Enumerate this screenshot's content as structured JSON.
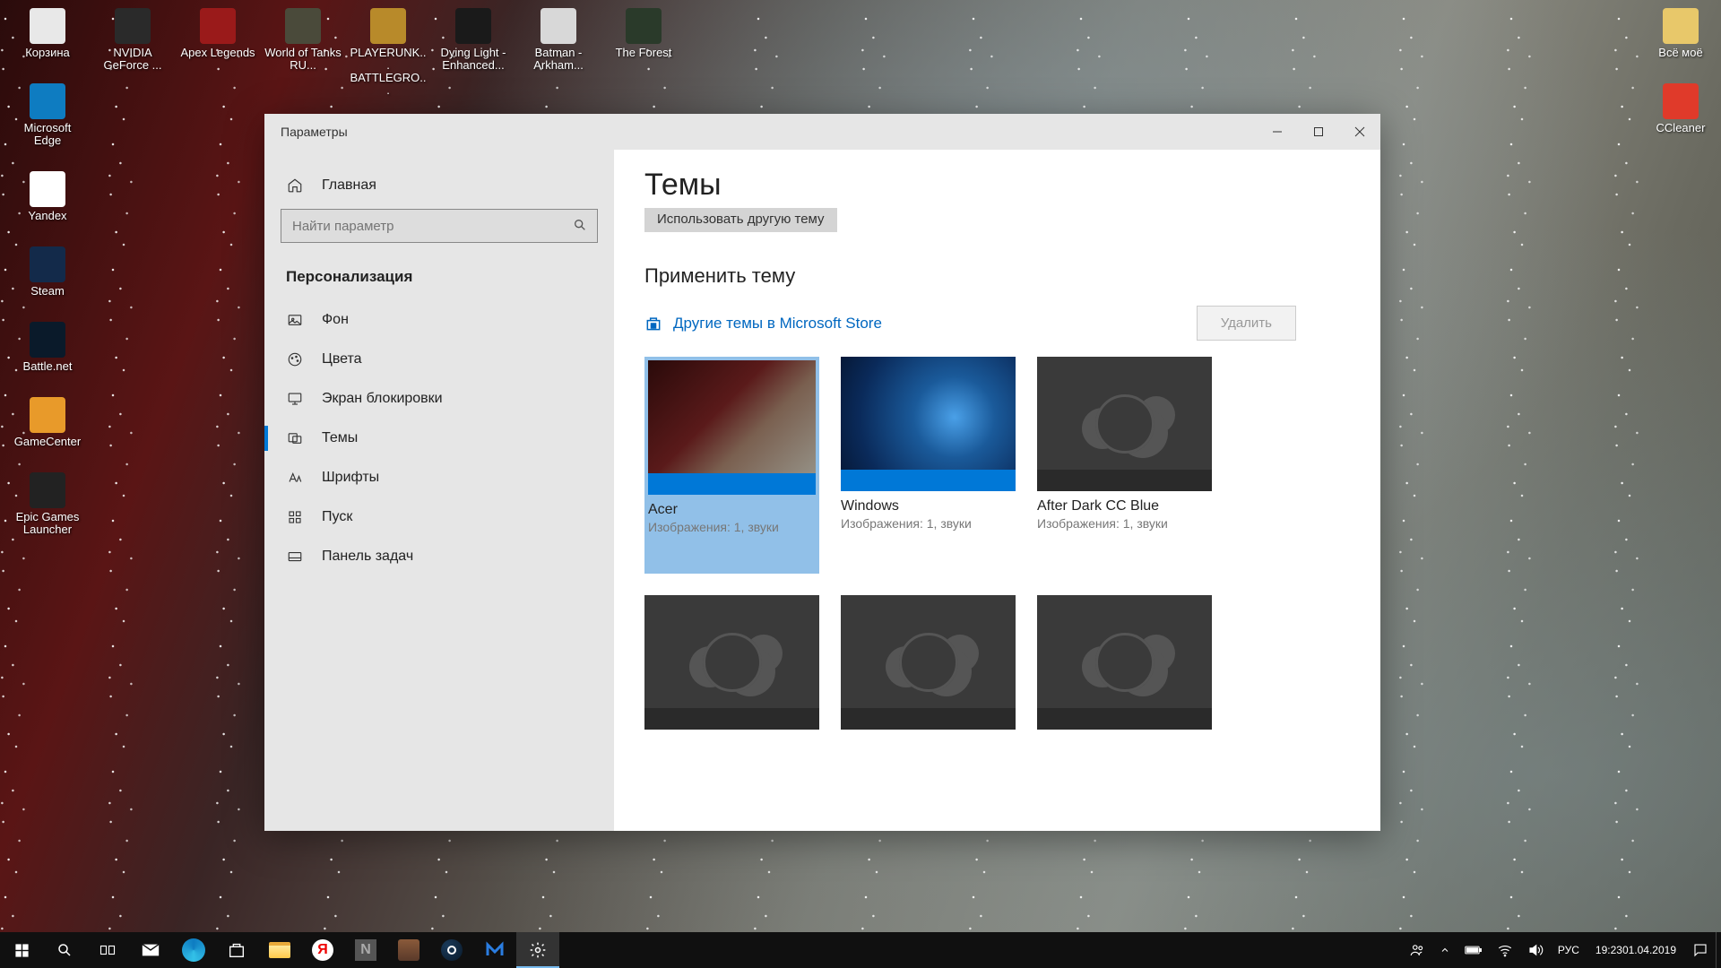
{
  "desktop_icons": {
    "col1": [
      "Корзина",
      "Microsoft Edge",
      "Yandex",
      "Steam",
      "Battle.net",
      "GameCenter",
      "Epic Games Launcher"
    ],
    "col2": [
      "NVIDIA GeForce ..."
    ],
    "col3": [
      "Apex Legends"
    ],
    "col4": [
      "World of Tanks RU..."
    ],
    "col5": [
      "PLAYERUNK... BATTLEGRO..."
    ],
    "col6": [
      "Dying Light - Enhanced..."
    ],
    "col7": [
      "Batman - Arkham..."
    ],
    "col8": [
      "The Forest"
    ],
    "col_right": [
      "Всё моё",
      "CCleaner"
    ]
  },
  "settings": {
    "window_title": "Параметры",
    "home_label": "Главная",
    "search_placeholder": "Найти параметр",
    "category_heading": "Персонализация",
    "nav": {
      "background": "Фон",
      "colors": "Цвета",
      "lockscreen": "Экран блокировки",
      "themes": "Темы",
      "fonts": "Шрифты",
      "start": "Пуск",
      "taskbar": "Панель задач"
    },
    "page_title": "Темы",
    "subtitle": "Использовать другую тему",
    "apply_heading": "Применить тему",
    "store_link": "Другие темы в Microsoft Store",
    "delete_label": "Удалить",
    "themes": [
      {
        "name": "Acer",
        "sub": "Изображения: 1, звуки",
        "selected": true,
        "style": "acer",
        "accent": "#0078d7"
      },
      {
        "name": "Windows",
        "sub": "Изображения: 1, звуки",
        "selected": false,
        "style": "win",
        "accent": "#0078d7"
      },
      {
        "name": "After Dark CC Blue",
        "sub": "Изображения: 1, звуки",
        "selected": false,
        "style": "dark",
        "accent": "#2a2a2a"
      },
      {
        "name": "",
        "sub": "",
        "selected": false,
        "style": "dark",
        "accent": "#2a2a2a"
      },
      {
        "name": "",
        "sub": "",
        "selected": false,
        "style": "dark",
        "accent": "#2a2a2a"
      },
      {
        "name": "",
        "sub": "",
        "selected": false,
        "style": "dark",
        "accent": "#2a2a2a"
      }
    ]
  },
  "taskbar": {
    "lang": "РУС",
    "time": "19:23",
    "date": "01.04.2019"
  }
}
